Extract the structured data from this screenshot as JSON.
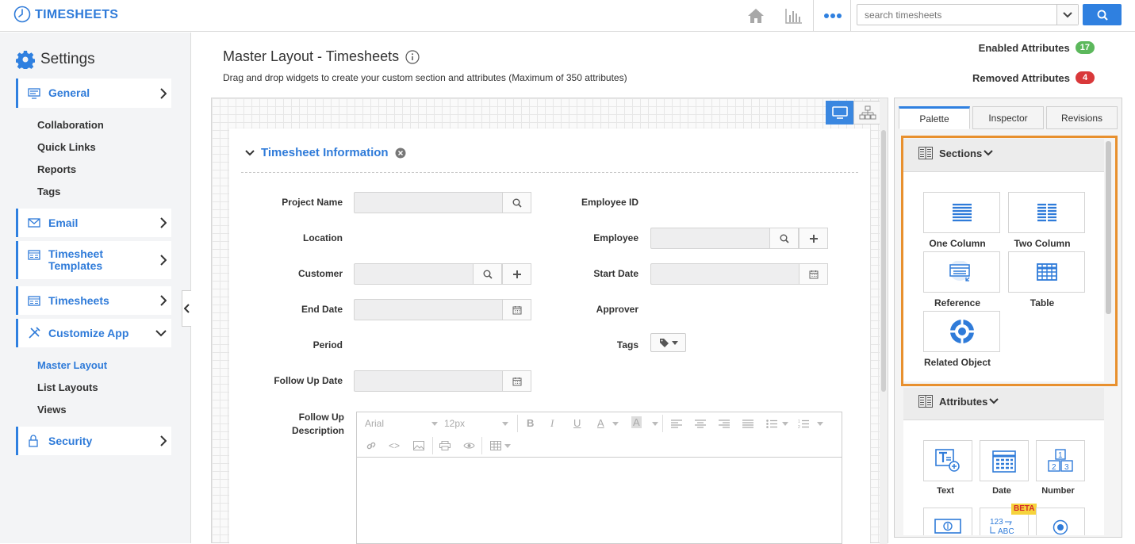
{
  "app": {
    "title": "TIMESHEETS"
  },
  "topbar": {
    "search_placeholder": "search timesheets"
  },
  "sidebar": {
    "title": "Settings",
    "items": [
      {
        "label": "General"
      },
      {
        "label": "Email"
      },
      {
        "label": "Timesheet Templates"
      },
      {
        "label": "Timesheets"
      },
      {
        "label": "Customize App"
      },
      {
        "label": "Security"
      }
    ],
    "general_sub": [
      "Collaboration",
      "Quick Links",
      "Reports",
      "Tags"
    ],
    "customize_sub": [
      "Master Layout",
      "List Layouts",
      "Views"
    ]
  },
  "header": {
    "title": "Master Layout - Timesheets",
    "subtitle": "Drag and drop widgets to create your custom section and attributes (Maximum of 350 attributes)",
    "enabled_label": "Enabled Attributes",
    "enabled_count": "17",
    "removed_label": "Removed Attributes",
    "removed_count": "4",
    "colors": {
      "enabled": "#5cb85c",
      "removed": "#d9383a"
    }
  },
  "form": {
    "section_title": "Timesheet Information",
    "fields": {
      "project_name": "Project Name",
      "employee_id": "Employee ID",
      "location": "Location",
      "employee": "Employee",
      "customer": "Customer",
      "start_date": "Start Date",
      "end_date": "End Date",
      "approver": "Approver",
      "period": "Period",
      "tags": "Tags",
      "follow_up_date": "Follow Up Date",
      "follow_up_description": "Follow Up Description"
    },
    "editor": {
      "font": "Arial",
      "size": "12px"
    }
  },
  "panel": {
    "tabs": [
      "Palette",
      "Inspector",
      "Revisions"
    ],
    "sections_header": "Sections",
    "sections": [
      "One Column",
      "Two Column",
      "Reference",
      "Table",
      "Related Object"
    ],
    "attributes_header": "Attributes",
    "attributes": [
      "Text",
      "Date",
      "Number"
    ],
    "beta_label": "BETA",
    "autonumber_text": "123",
    "autonumber_text2": "ABC"
  },
  "accent_color": "#2f80e0",
  "highlight_color": "#e8902e"
}
